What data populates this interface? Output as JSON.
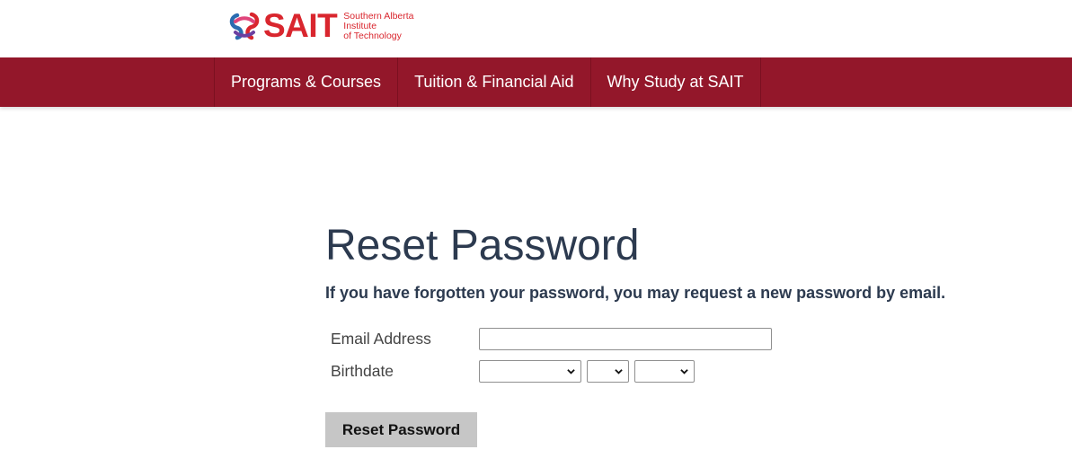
{
  "brand": {
    "wordmark": "SAIT",
    "tagline": [
      "Southern Alberta",
      "Institute",
      "of Technology"
    ],
    "accent_color": "#d9262e",
    "nav_color": "#93172a"
  },
  "nav": {
    "items": [
      {
        "label": "Programs & Courses"
      },
      {
        "label": "Tuition & Financial Aid"
      },
      {
        "label": "Why Study at SAIT"
      }
    ]
  },
  "page": {
    "title": "Reset Password",
    "intro": "If you have forgotten your password, you may request a new password by email."
  },
  "form": {
    "email_label": "Email Address",
    "email_value": "",
    "birthdate_label": "Birthdate",
    "month_value": "",
    "day_value": "",
    "year_value": "",
    "submit_label": "Reset Password"
  }
}
